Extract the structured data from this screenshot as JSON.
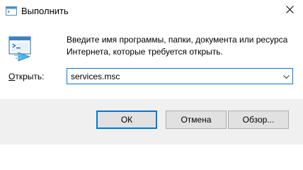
{
  "window": {
    "title": "Выполнить",
    "icon": "run-dialog-icon",
    "close_icon": "close-icon"
  },
  "dialog": {
    "description": "Введите имя программы, папки, документа или ресурса Интернета, которые требуется открыть.",
    "large_icon": "run-dialog-icon"
  },
  "open_field": {
    "label_underlined": "О",
    "label_rest": "ткрыть:",
    "value": "services.msc",
    "dropdown_icon": "chevron-down-icon"
  },
  "buttons": {
    "ok": "ОК",
    "cancel": "Отмена",
    "browse": "Обзор..."
  },
  "colors": {
    "accent": "#0078d7",
    "footer_bg": "#f0f0f0",
    "button_bg": "#e1e1e1"
  }
}
